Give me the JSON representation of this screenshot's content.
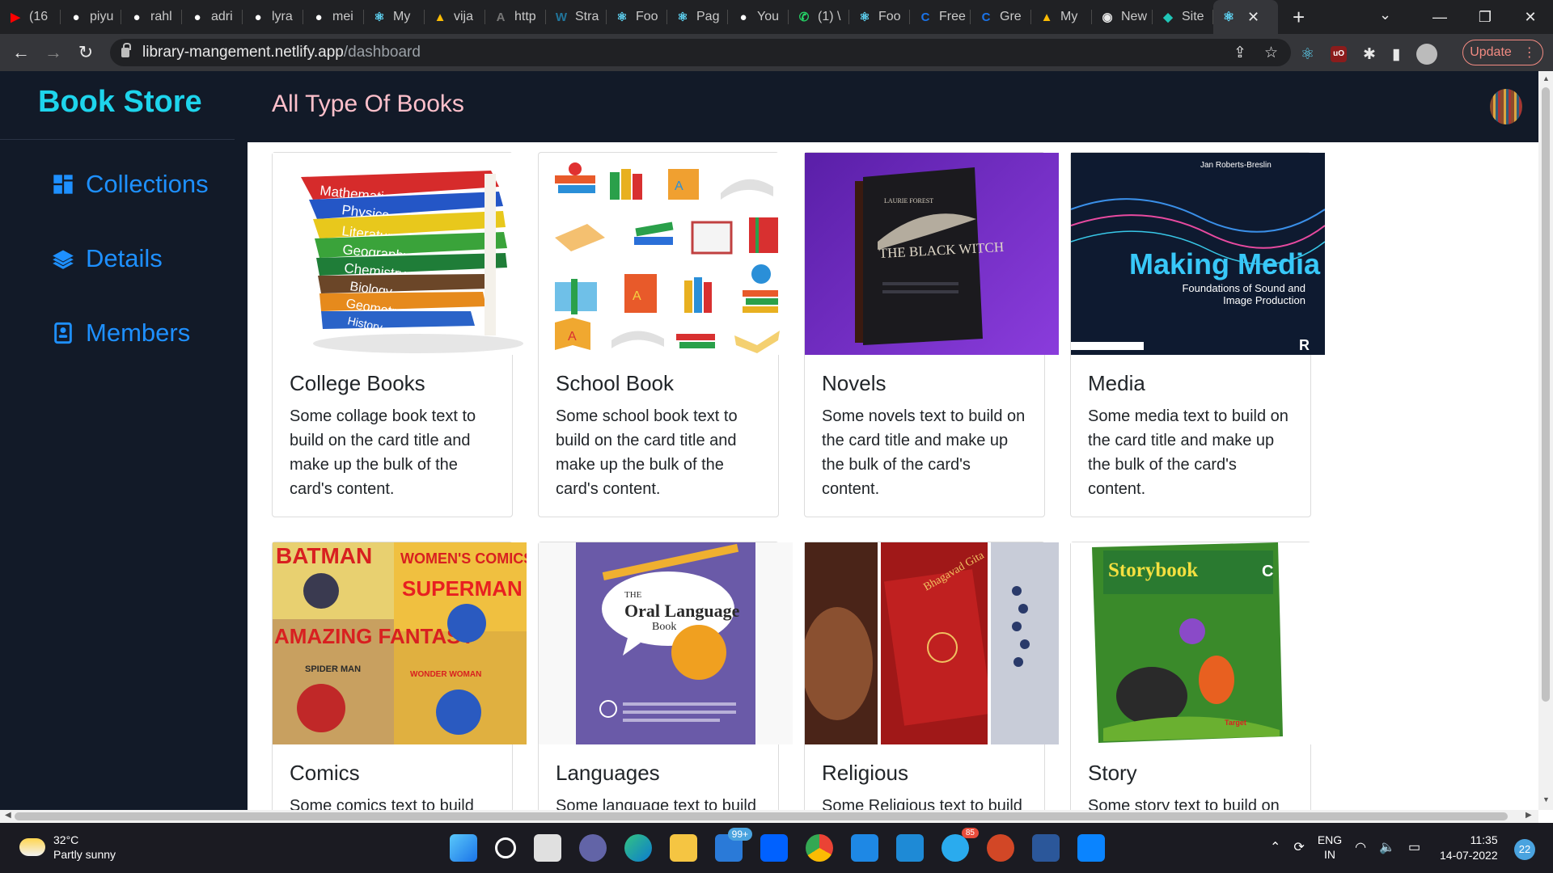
{
  "browser": {
    "tabs": [
      {
        "label": "(16",
        "icon": "youtube-icon",
        "color": "#ff0000"
      },
      {
        "label": "piyu",
        "icon": "github-icon",
        "color": "#ffffff"
      },
      {
        "label": "rahl",
        "icon": "github-icon",
        "color": "#ffffff"
      },
      {
        "label": "adri",
        "icon": "github-icon",
        "color": "#ffffff"
      },
      {
        "label": "lyra",
        "icon": "github-icon",
        "color": "#ffffff"
      },
      {
        "label": "mei",
        "icon": "github-icon",
        "color": "#ffffff"
      },
      {
        "label": "My",
        "icon": "react-icon",
        "color": "#61dafb"
      },
      {
        "label": "vija",
        "icon": "google-drive-icon",
        "color": "#fbbc04"
      },
      {
        "label": "http",
        "icon": "api-icon",
        "color": "#777777"
      },
      {
        "label": "Stra",
        "icon": "wordpress-icon",
        "color": "#21759b"
      },
      {
        "label": "Foo",
        "icon": "react-icon",
        "color": "#61dafb"
      },
      {
        "label": "Pag",
        "icon": "react-icon",
        "color": "#61dafb"
      },
      {
        "label": "You",
        "icon": "github-icon",
        "color": "#ffffff"
      },
      {
        "label": "(1) \\",
        "icon": "whatsapp-icon",
        "color": "#25d366"
      },
      {
        "label": "Foo",
        "icon": "react-icon",
        "color": "#61dafb"
      },
      {
        "label": "Free",
        "icon": "codepen-icon",
        "color": "#1a73e8"
      },
      {
        "label": "Gre",
        "icon": "codepen-icon",
        "color": "#1a73e8"
      },
      {
        "label": "My",
        "icon": "google-drive-icon",
        "color": "#fbbc04"
      },
      {
        "label": "New",
        "icon": "chrome-icon",
        "color": "#e8e8e8"
      },
      {
        "label": "Site",
        "icon": "netlify-icon",
        "color": "#20c6b7"
      }
    ],
    "active_tab_icon": "react-icon",
    "url_host": "library-mangement.netlify.app",
    "url_path": "/dashboard",
    "update_label": "Update"
  },
  "app": {
    "brand": "Book Store",
    "page_title": "All Type Of Books",
    "colors": {
      "navy": "#121a28",
      "brand": "#1ed4ec",
      "title": "#ffc0cb",
      "link": "#1e90ff"
    },
    "sidebar": [
      {
        "label": "Collections",
        "icon": "dashboard-grid-icon"
      },
      {
        "label": "Details",
        "icon": "layers-icon"
      },
      {
        "label": "Members",
        "icon": "contact-book-icon"
      }
    ],
    "cards": [
      {
        "title": "College Books",
        "text": "Some collage book text to build on the card title and make up the bulk of the card's content.",
        "image": "stacked-textbooks-image"
      },
      {
        "title": "School Book",
        "text": "Some school book text to build on the card title and make up the bulk of the card's content.",
        "image": "school-book-icons-image"
      },
      {
        "title": "Novels",
        "text": "Some novels text to build on the card title and make up the bulk of the card's content.",
        "image": "black-witch-novel-image"
      },
      {
        "title": "Media",
        "text": "Some media text to build on the card title and make up the bulk of the card's content.",
        "image": "making-media-cover-image"
      },
      {
        "title": "Comics",
        "text": "Some comics text to build",
        "image": "comic-covers-image"
      },
      {
        "title": "Languages",
        "text": "Some language text to build",
        "image": "oral-language-book-image"
      },
      {
        "title": "Religious",
        "text": "Some Religious text to build",
        "image": "religious-books-image"
      },
      {
        "title": "Story",
        "text": "Some story text to build on",
        "image": "storybook-cover-image"
      }
    ],
    "book_covers": {
      "college_spines": [
        "Mathematics",
        "Physics",
        "Literature",
        "Geography",
        "Chemistry",
        "Biology",
        "Geometry",
        "History"
      ],
      "novel_author": "LAURIE FOREST",
      "novel_title": "THE BLACK WITCH",
      "media_author": "Jan Roberts-Breslin",
      "media_title": "Making Media",
      "media_subtitle": "Foundations of Sound and Image Production",
      "media_publisher_logo": "R",
      "comics_words": [
        "BATMAN",
        "WOMEN'S COMICS",
        "SUPERMAN",
        "AMAZING FANTASY",
        "SPIDER MAN",
        "WONDER WOMAN"
      ],
      "oral_title_small": "THE",
      "oral_title": "Oral Language",
      "oral_title_book": "Book",
      "religious_label": "Bhagavad Gita",
      "story_title": "Storybook",
      "story_grade": "C",
      "story_publisher": "Target"
    }
  },
  "taskbar": {
    "temperature": "32°C",
    "weather": "Partly sunny",
    "mail_badge": "99+",
    "telegram_badge": "85",
    "lang_top": "ENG",
    "lang_bottom": "IN",
    "time": "11:35",
    "date": "14-07-2022",
    "notifications": "22"
  }
}
